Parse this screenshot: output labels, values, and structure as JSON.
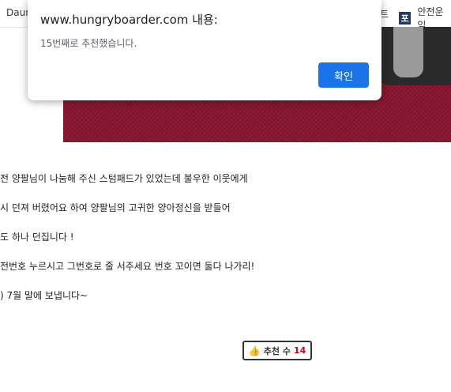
{
  "bookmarks": {
    "left_label": "Daum",
    "right_fragment": "트",
    "right_icon_char": "포",
    "right_label": "안전운임"
  },
  "article": {
    "lines": [
      "전 양팔님이 나눔해 주신 스텀패드가 있었는데 불우한 이웃에게",
      "시 던져 버렸어요 하여 양팔님의 고귀한 양아정신을 받들어",
      "도 하나 던집니다 !",
      "전번호 누르시고 그번호로 줄 서주세요 번호 꼬이면 둘다 나가리!",
      ") 7월 말에 보냅니다~"
    ]
  },
  "recommend": {
    "label": "추천 수",
    "count": "14",
    "icon": "thumbs-up-icon"
  },
  "dialog": {
    "title": "www.hungryboarder.com 내용:",
    "message": "15번째로 추천했습니다.",
    "ok_label": "확인"
  },
  "colors": {
    "accent": "#1a73e8",
    "hero": "#86162f",
    "count": "#d0021b"
  }
}
